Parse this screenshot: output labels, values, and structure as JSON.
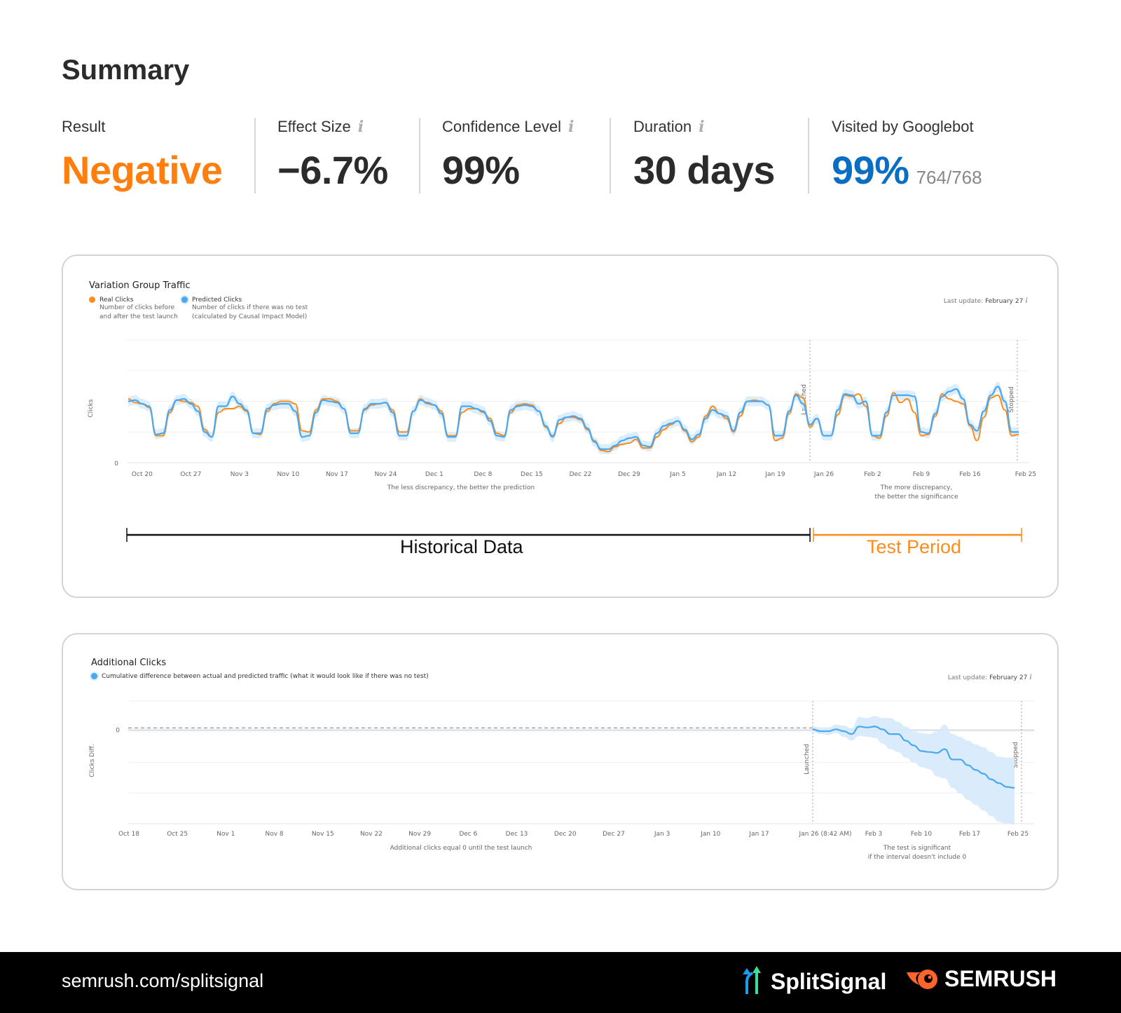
{
  "summary": {
    "title": "Summary",
    "metrics": [
      {
        "label": "Result",
        "value": "Negative",
        "has_info": false,
        "color": "#ff7f0e"
      },
      {
        "label": "Effect Size",
        "value": "−6.7%",
        "has_info": true,
        "color": "#2b2b2b"
      },
      {
        "label": "Confidence Level",
        "value": "99%",
        "has_info": true,
        "color": "#2b2b2b"
      },
      {
        "label": "Duration",
        "value": "30 days",
        "has_info": true,
        "color": "#2b2b2b"
      },
      {
        "label": "Visited by Googlebot",
        "value": "99%",
        "sub": "764/768",
        "has_info": false,
        "color": "#0a6fc2"
      }
    ],
    "info_glyph": "i"
  },
  "traffic_card": {
    "title": "Variation Group Traffic",
    "legend": [
      {
        "name": "Real Clicks",
        "desc1": "Number of clicks before",
        "desc2": "and after the test launch",
        "color": "#ff8c1a"
      },
      {
        "name": "Predicted Clicks",
        "desc1": "Number of clicks if there was no test",
        "desc2": "(calculated by Causal Impact Model)",
        "color": "#4aa8f0"
      }
    ],
    "last_update_label": "Last update:",
    "last_update_value": "February 27",
    "note_left": "The less discrepancy, the better the prediction",
    "note_right_1": "The more discrepancy,",
    "note_right_2": "the better the significance",
    "periods": {
      "historical": "Historical Data",
      "test": "Test Period"
    }
  },
  "additional_card": {
    "title": "Additional Clicks",
    "legend": "Cumulative difference between actual and predicted traffic (what it would look like if there was no test)",
    "last_update_label": "Last update:",
    "last_update_value": "February 27",
    "note_left": "Additional clicks equal 0 until the test launch",
    "note_right_1": "The test is significant",
    "note_right_2": "if the interval doesn't include 0"
  },
  "footer": {
    "url": "semrush.com/splitsignal",
    "brand1": "SplitSignal",
    "brand2": "SEMRUSH"
  },
  "chart_data": [
    {
      "type": "line",
      "title": "Variation Group Traffic",
      "ylabel": "Clicks",
      "xlabel": "",
      "y_ticks": [
        "0"
      ],
      "ylim": [
        0,
        100
      ],
      "grid": true,
      "x_ticks": [
        "Oct 20",
        "Oct 27",
        "Nov 3",
        "Nov 10",
        "Nov 17",
        "Nov 24",
        "Dec 1",
        "Dec 8",
        "Dec 15",
        "Dec 22",
        "Dec 29",
        "Jan 5",
        "Jan 12",
        "Jan 19",
        "Jan 26",
        "Feb 2",
        "Feb 9",
        "Feb 16",
        "Feb 25"
      ],
      "x_start_day": -2,
      "launch_day": 98,
      "stop_day": 128,
      "markers": {
        "launched": "Launched",
        "stopped": "Stopped"
      },
      "series": [
        {
          "name": "Real Clicks",
          "color": "#ff8c1a",
          "values": [
            52,
            49,
            48,
            45,
            22,
            22,
            41,
            51,
            50,
            49,
            46,
            27,
            21,
            41,
            44,
            44,
            46,
            42,
            24,
            23,
            42,
            48,
            50,
            50,
            48,
            26,
            25,
            43,
            52,
            52,
            50,
            44,
            26,
            26,
            43,
            47,
            48,
            49,
            43,
            25,
            25,
            42,
            52,
            48,
            47,
            42,
            22,
            22,
            41,
            44,
            44,
            41,
            36,
            24,
            22,
            41,
            47,
            48,
            47,
            42,
            29,
            22,
            32,
            37,
            37,
            35,
            27,
            18,
            10,
            9,
            13,
            15,
            16,
            19,
            12,
            12,
            21,
            27,
            31,
            34,
            26,
            17,
            21,
            38,
            46,
            40,
            36,
            25,
            38,
            50,
            51,
            50,
            47,
            18,
            20,
            40,
            56,
            53,
            29,
            36,
            22,
            22,
            39,
            55,
            54,
            56,
            46,
            22,
            20,
            38,
            57,
            49,
            52,
            41,
            22,
            23,
            38,
            56,
            52,
            50,
            48,
            30,
            18,
            37,
            53,
            55,
            43,
            22,
            23
          ]
        },
        {
          "name": "Predicted Clicks",
          "color": "#4aa8f0",
          "values": [
            50,
            51,
            48,
            46,
            23,
            24,
            43,
            51,
            52,
            48,
            42,
            25,
            21,
            46,
            46,
            54,
            48,
            43,
            24,
            24,
            44,
            47,
            48,
            48,
            42,
            21,
            22,
            41,
            51,
            50,
            49,
            44,
            24,
            24,
            44,
            48,
            48,
            49,
            41,
            22,
            22,
            42,
            51,
            49,
            47,
            40,
            21,
            21,
            46,
            46,
            44,
            42,
            34,
            22,
            21,
            43,
            46,
            47,
            46,
            42,
            30,
            21,
            35,
            37,
            38,
            36,
            28,
            17,
            11,
            11,
            14,
            18,
            20,
            21,
            14,
            13,
            24,
            30,
            32,
            34,
            27,
            19,
            23,
            36,
            43,
            40,
            38,
            26,
            41,
            50,
            50,
            50,
            47,
            22,
            22,
            42,
            55,
            48,
            31,
            36,
            22,
            22,
            43,
            56,
            55,
            48,
            50,
            22,
            22,
            41,
            55,
            55,
            55,
            54,
            25,
            24,
            40,
            54,
            58,
            60,
            52,
            31,
            26,
            42,
            55,
            62,
            50,
            25,
            25
          ]
        },
        {
          "name": "Predicted Interval",
          "color": "#d6eafc",
          "band": 4
        }
      ]
    },
    {
      "type": "area",
      "title": "Additional Clicks",
      "ylabel": "Clicks Diff.",
      "xlabel": "",
      "y_ticks": [
        "0"
      ],
      "ylim": [
        -100,
        30
      ],
      "grid": true,
      "x_ticks": [
        "Oct 18",
        "Oct 25",
        "Nov 1",
        "Nov 8",
        "Nov 15",
        "Nov 22",
        "Nov 29",
        "Dec 6",
        "Dec 13",
        "Dec 20",
        "Dec 27",
        "Jan 3",
        "Jan 10",
        "Jan 17",
        "Jan 26 (8:42 AM)",
        "Feb 3",
        "Feb 10",
        "Feb 17",
        "Feb 25"
      ],
      "launch_label": "Launched",
      "stop_label": "Stopped",
      "series": [
        {
          "name": "Cumulative difference",
          "color": "#4aa8f0",
          "pre_launch_value": 0,
          "values": [
            0,
            -2,
            -2,
            0,
            -2,
            -5,
            3,
            2,
            3,
            0,
            -5,
            -5,
            -12,
            -17,
            -23,
            -24,
            -25,
            -21,
            -32,
            -32,
            -38,
            -43,
            -47,
            -53,
            -57,
            -61,
            -62
          ],
          "lower": [
            -3,
            -5,
            -6,
            -4,
            -8,
            -12,
            -7,
            -8,
            -9,
            -15,
            -21,
            -24,
            -30,
            -35,
            -40,
            -42,
            -50,
            -52,
            -62,
            -68,
            -75,
            -80,
            -86,
            -92,
            -98,
            -100,
            -101
          ],
          "upper": [
            3,
            2,
            2,
            5,
            4,
            1,
            13,
            12,
            14,
            12,
            12,
            8,
            3,
            -2,
            -4,
            -5,
            -2,
            5,
            -5,
            -8,
            -12,
            -16,
            -19,
            -24,
            -29,
            -30,
            -30
          ]
        }
      ]
    }
  ]
}
